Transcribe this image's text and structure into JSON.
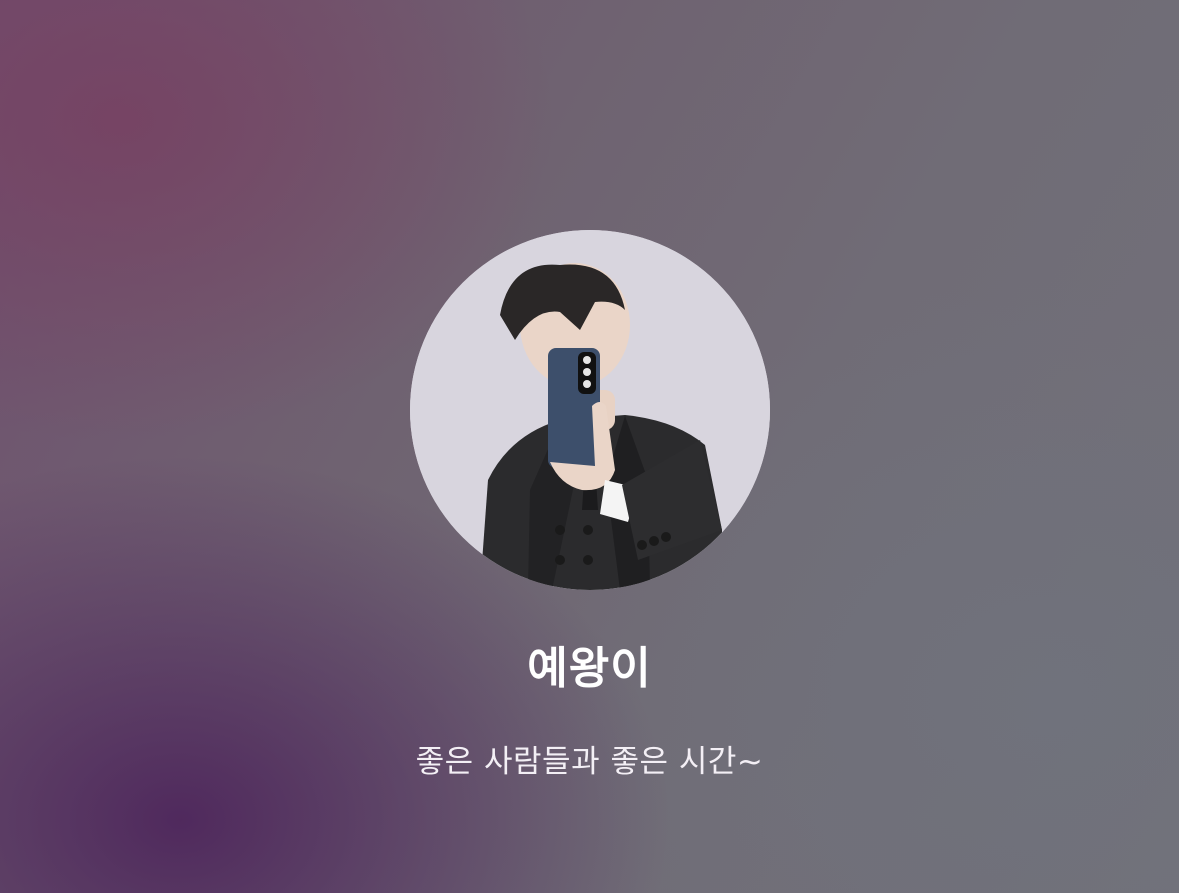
{
  "profile": {
    "name": "예왕이",
    "status_message": "좋은 사람들과 좋은 시간~",
    "avatar_icon": "profile-photo-avatar"
  },
  "colors": {
    "bg_purple": "#4e265c",
    "bg_gray": "#72717a",
    "avatar_bg": "#d7d4dc",
    "text": "#ffffff"
  }
}
